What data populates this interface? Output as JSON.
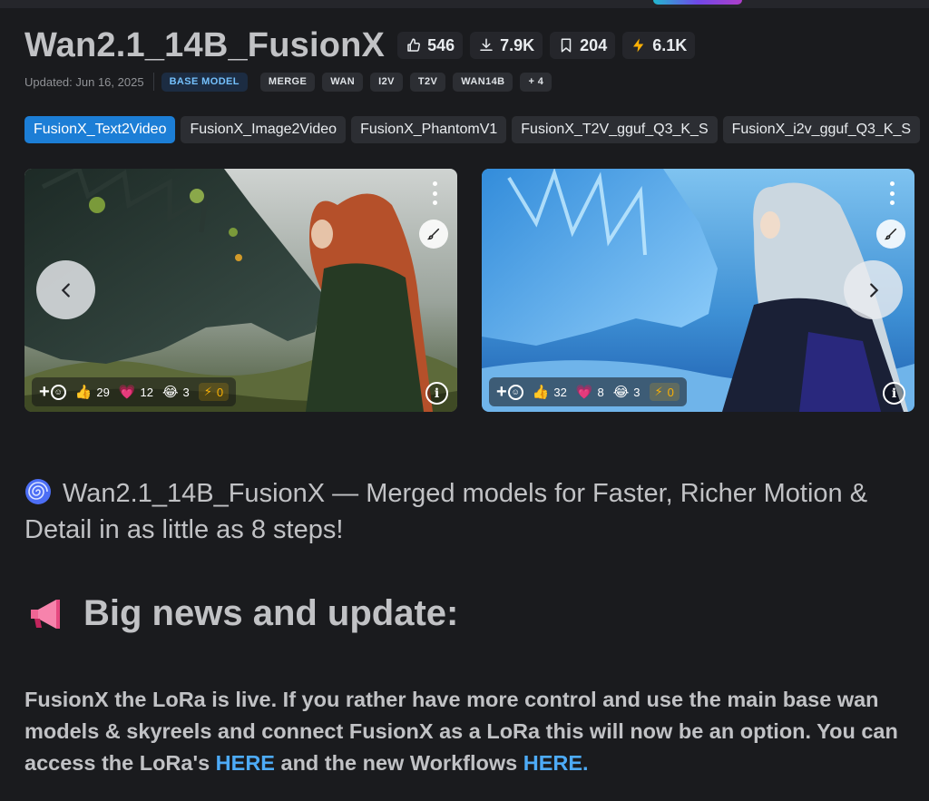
{
  "header": {
    "title": "Wan2.1_14B_FusionX",
    "stats": {
      "likes": "546",
      "downloads": "7.9K",
      "bookmarks": "204",
      "buzz": "6.1K"
    },
    "updated": "Updated: Jun 16, 2025",
    "base_badge": "BASE MODEL",
    "tags": [
      "MERGE",
      "WAN",
      "I2V",
      "T2V",
      "WAN14B",
      "+ 4"
    ]
  },
  "versions": [
    {
      "label": "FusionX_Text2Video",
      "active": true
    },
    {
      "label": "FusionX_Image2Video",
      "active": false
    },
    {
      "label": "FusionX_PhantomV1",
      "active": false
    },
    {
      "label": "FusionX_T2V_gguf_Q3_K_S",
      "active": false
    },
    {
      "label": "FusionX_i2v_gguf_Q3_K_S",
      "active": false
    }
  ],
  "gallery": [
    {
      "reactions": {
        "like": "29",
        "heart": "12",
        "laugh": "3",
        "buzz": "0"
      }
    },
    {
      "reactions": {
        "like": "32",
        "heart": "8",
        "laugh": "3",
        "buzz": "0"
      }
    }
  ],
  "description": {
    "headline": "Wan2.1_14B_FusionX — Merged models for Faster, Richer Motion & Detail in as little as 8 steps!",
    "news_heading": "Big news and update:",
    "news_text_1": "FusionX the LoRa is live. If you rather have more control and use the main base wan models & skyreels and connect FusionX as a LoRa this will now be an option. You can access the LoRa's ",
    "link_1": "HERE",
    "news_text_2": " and the new Workflows ",
    "link_2": "HERE."
  },
  "colors": {
    "background": "#1a1b1e",
    "accent": "#1c7ed6",
    "link": "#4dabf7",
    "buzz": "#fab005"
  },
  "icons": [
    "thumbs-up-icon",
    "download-icon",
    "bookmark-icon",
    "bolt-icon",
    "more-vertical-icon",
    "remix-brush-icon",
    "info-icon",
    "chevron-left-icon",
    "chevron-right-icon",
    "spiral-icon",
    "megaphone-icon"
  ]
}
